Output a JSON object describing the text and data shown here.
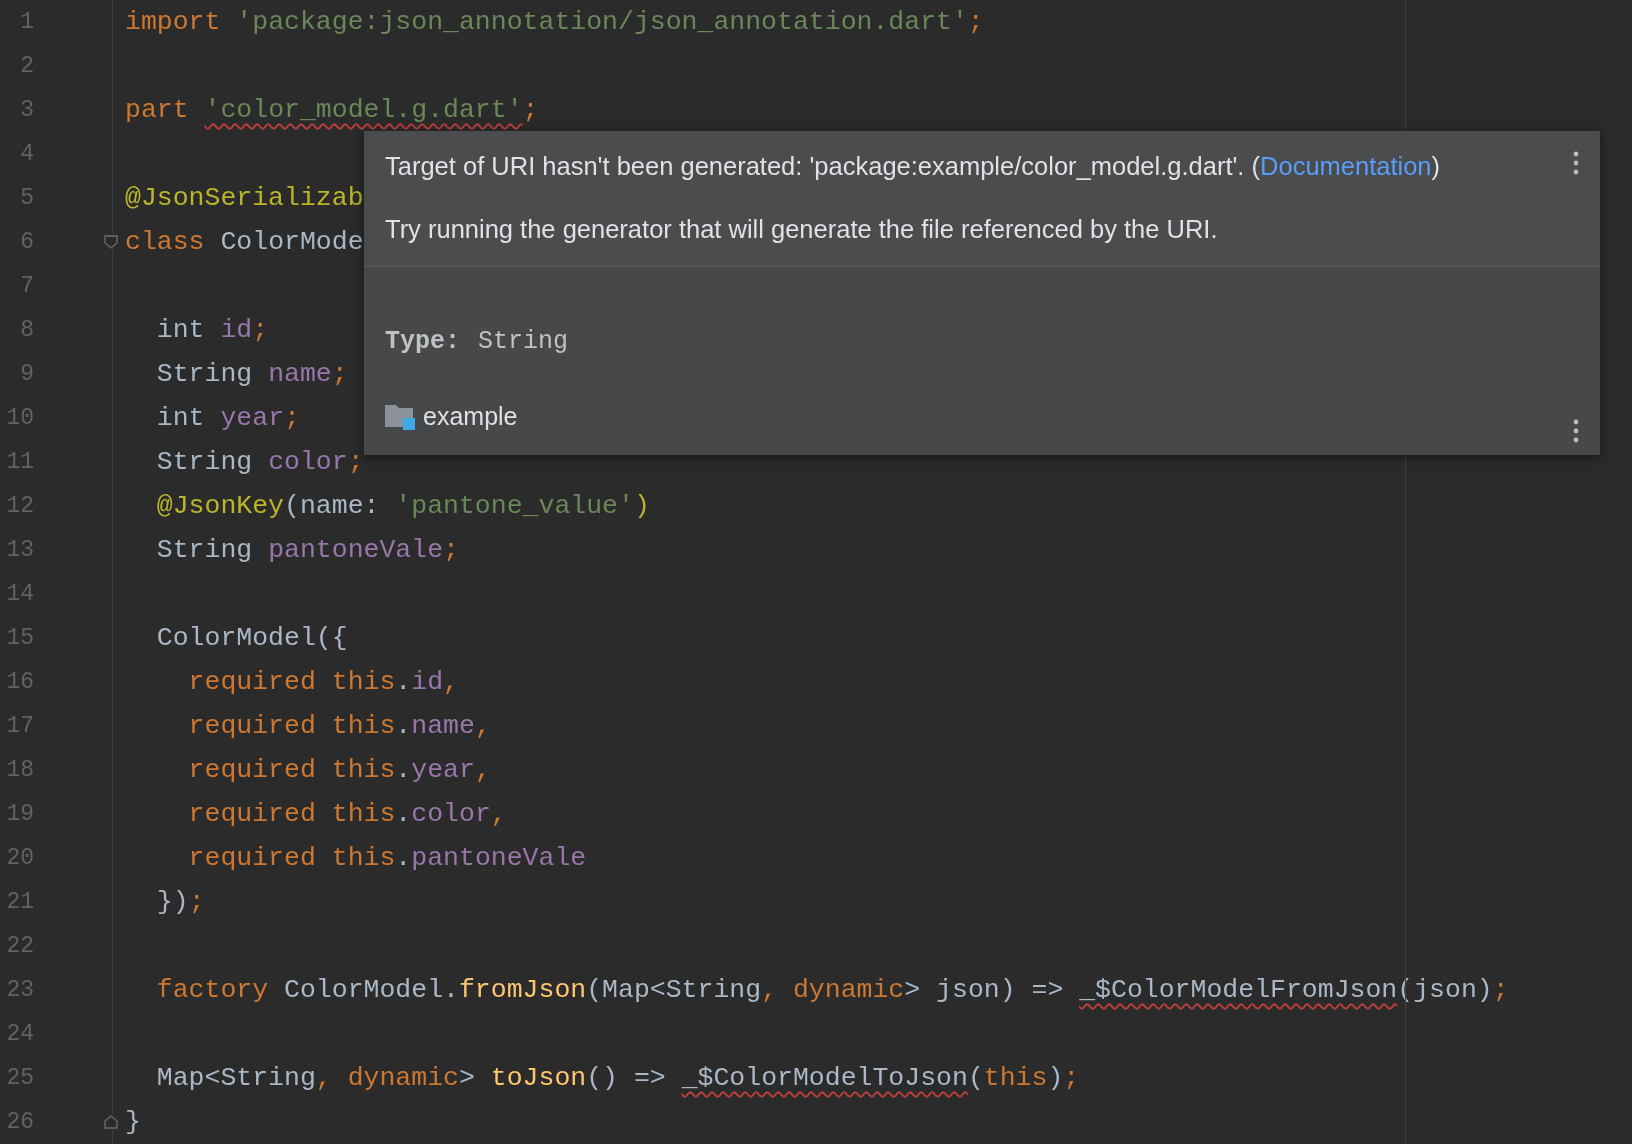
{
  "editor": {
    "lines": [
      {
        "number": "1",
        "tokens": [
          {
            "text": "import ",
            "kind": "keyword"
          },
          {
            "text": "'package:json_annotation/json_annotation.dart'",
            "kind": "string"
          },
          {
            "text": ";",
            "kind": "punct"
          }
        ]
      },
      {
        "number": "2"
      },
      {
        "number": "3",
        "tokens": [
          {
            "text": "part ",
            "kind": "keyword"
          },
          {
            "text": "'color_model.g.dart'",
            "kind": "string",
            "error": true
          },
          {
            "text": ";",
            "kind": "punct"
          }
        ]
      },
      {
        "number": "4"
      },
      {
        "number": "5",
        "tokens": [
          {
            "text": "@JsonSerializab",
            "kind": "annotation"
          }
        ]
      },
      {
        "number": "6",
        "fold_start": true,
        "tokens": [
          {
            "text": "class ",
            "kind": "keyword"
          },
          {
            "text": "ColorMode",
            "kind": "plain"
          }
        ]
      },
      {
        "number": "7"
      },
      {
        "number": "8",
        "tokens": [
          {
            "text": "  int ",
            "kind": "plain"
          },
          {
            "text": "id",
            "kind": "field"
          },
          {
            "text": ";",
            "kind": "punct"
          }
        ]
      },
      {
        "number": "9",
        "tokens": [
          {
            "text": "  String ",
            "kind": "plain"
          },
          {
            "text": "name",
            "kind": "field"
          },
          {
            "text": ";",
            "kind": "punct"
          }
        ]
      },
      {
        "number": "10",
        "tokens": [
          {
            "text": "  int ",
            "kind": "plain"
          },
          {
            "text": "year",
            "kind": "field"
          },
          {
            "text": ";",
            "kind": "punct"
          }
        ]
      },
      {
        "number": "11",
        "tokens": [
          {
            "text": "  String ",
            "kind": "plain"
          },
          {
            "text": "color",
            "kind": "field"
          },
          {
            "text": ";",
            "kind": "punct"
          }
        ]
      },
      {
        "number": "12",
        "tokens": [
          {
            "text": "  @JsonKey",
            "kind": "annotation"
          },
          {
            "text": "(name: ",
            "kind": "plain"
          },
          {
            "text": "'pantone_value'",
            "kind": "string"
          },
          {
            "text": ")",
            "kind": "annotation"
          }
        ]
      },
      {
        "number": "13",
        "tokens": [
          {
            "text": "  String ",
            "kind": "plain"
          },
          {
            "text": "pantoneVale",
            "kind": "field"
          },
          {
            "text": ";",
            "kind": "punct"
          }
        ]
      },
      {
        "number": "14"
      },
      {
        "number": "15",
        "tokens": [
          {
            "text": "  ColorModel({",
            "kind": "plain"
          }
        ]
      },
      {
        "number": "16",
        "tokens": [
          {
            "text": "    required this",
            "kind": "keyword"
          },
          {
            "text": ".",
            "kind": "plain"
          },
          {
            "text": "id",
            "kind": "field"
          },
          {
            "text": ",",
            "kind": "punct"
          }
        ]
      },
      {
        "number": "17",
        "tokens": [
          {
            "text": "    required this",
            "kind": "keyword"
          },
          {
            "text": ".",
            "kind": "plain"
          },
          {
            "text": "name",
            "kind": "field"
          },
          {
            "text": ",",
            "kind": "punct"
          }
        ]
      },
      {
        "number": "18",
        "tokens": [
          {
            "text": "    required this",
            "kind": "keyword"
          },
          {
            "text": ".",
            "kind": "plain"
          },
          {
            "text": "year",
            "kind": "field"
          },
          {
            "text": ",",
            "kind": "punct"
          }
        ]
      },
      {
        "number": "19",
        "tokens": [
          {
            "text": "    required this",
            "kind": "keyword"
          },
          {
            "text": ".",
            "kind": "plain"
          },
          {
            "text": "color",
            "kind": "field"
          },
          {
            "text": ",",
            "kind": "punct"
          }
        ]
      },
      {
        "number": "20",
        "tokens": [
          {
            "text": "    required this",
            "kind": "keyword"
          },
          {
            "text": ".",
            "kind": "plain"
          },
          {
            "text": "pantoneVale",
            "kind": "field"
          }
        ]
      },
      {
        "number": "21",
        "tokens": [
          {
            "text": "  })",
            "kind": "plain"
          },
          {
            "text": ";",
            "kind": "punct"
          }
        ]
      },
      {
        "number": "22"
      },
      {
        "number": "23",
        "tokens": [
          {
            "text": "  factory ",
            "kind": "keyword"
          },
          {
            "text": "ColorModel.",
            "kind": "plain"
          },
          {
            "text": "fromJson",
            "kind": "method"
          },
          {
            "text": "(Map<String",
            "kind": "plain"
          },
          {
            "text": ", dynamic",
            "kind": "keyword"
          },
          {
            "text": "> json) => ",
            "kind": "plain"
          },
          {
            "text": "_$ColorModelFromJson",
            "kind": "plain",
            "error": true
          },
          {
            "text": "(json)",
            "kind": "plain"
          },
          {
            "text": ";",
            "kind": "punct"
          }
        ]
      },
      {
        "number": "24"
      },
      {
        "number": "25",
        "tokens": [
          {
            "text": "  Map<String",
            "kind": "plain"
          },
          {
            "text": ", dynamic",
            "kind": "keyword"
          },
          {
            "text": "> ",
            "kind": "plain"
          },
          {
            "text": "toJson",
            "kind": "method"
          },
          {
            "text": "() => ",
            "kind": "plain"
          },
          {
            "text": "_$ColorModelToJson",
            "kind": "plain",
            "error": true
          },
          {
            "text": "(",
            "kind": "plain"
          },
          {
            "text": "this",
            "kind": "keyword"
          },
          {
            "text": ")",
            "kind": "plain"
          },
          {
            "text": ";",
            "kind": "punct"
          }
        ]
      },
      {
        "number": "26",
        "fold_end": true,
        "tokens": [
          {
            "text": "}",
            "kind": "plain"
          }
        ]
      }
    ]
  },
  "popup": {
    "message": {
      "text": "Target of URI hasn't been generated: 'package:example/color_model.g.dart'. (",
      "link": "Documentation",
      "after": ")"
    },
    "hint": "Try running the generator that will generate the file referenced by the URI.",
    "type_label": "Type:",
    "type_value": "String",
    "package": "example"
  }
}
